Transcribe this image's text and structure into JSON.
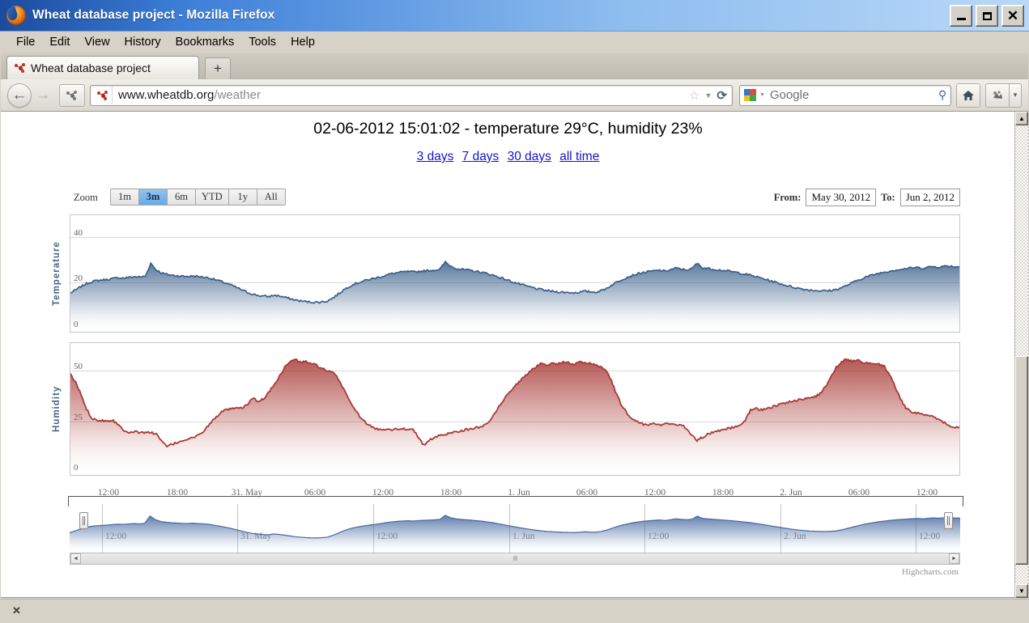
{
  "window": {
    "title": "Wheat database project - Mozilla Firefox",
    "minimize_label": "Minimize",
    "maximize_label": "Maximize",
    "close_label": "Close"
  },
  "menubar": {
    "items": [
      {
        "label": "File"
      },
      {
        "label": "Edit"
      },
      {
        "label": "View"
      },
      {
        "label": "History"
      },
      {
        "label": "Bookmarks"
      },
      {
        "label": "Tools"
      },
      {
        "label": "Help"
      }
    ]
  },
  "tabs": {
    "active_tab_title": "Wheat database project",
    "new_tab_label": "+"
  },
  "navbar": {
    "back_label": "←",
    "forward_label": "→",
    "reload_label": "↻",
    "url_host": "www.wheatdb.org",
    "url_path": "/weather",
    "star_label": "☆",
    "dropmarker_label": "▼",
    "reload_stop_label": "⟳",
    "search_engine": "Google",
    "search_placeholder": "Google",
    "search_icon_label": "⚲",
    "home_label": "⌂",
    "bookmarks_label": "❦",
    "bookmarks_caret": "▾"
  },
  "page": {
    "heading": "02-06-2012 15:01:02 - temperature 29°C, humidity 23%",
    "links": [
      {
        "label": "3 days"
      },
      {
        "label": "7 days"
      },
      {
        "label": "30 days"
      },
      {
        "label": "all time"
      }
    ],
    "credit": "Highcharts.com"
  },
  "rangeselector": {
    "zoom_label": "Zoom",
    "buttons": [
      {
        "label": "1m",
        "selected": false
      },
      {
        "label": "3m",
        "selected": true
      },
      {
        "label": "6m",
        "selected": false
      },
      {
        "label": "YTD",
        "selected": false
      },
      {
        "label": "1y",
        "selected": false
      },
      {
        "label": "All",
        "selected": false
      }
    ],
    "from_label": "From:",
    "from_value": "May 30, 2012",
    "to_label": "To:",
    "to_value": "Jun 2, 2012"
  },
  "navigator": {
    "scroll_left_label": "◄",
    "scroll_right_label": "►",
    "grip_label": "‖‖",
    "inner_ticks": [
      {
        "label": "12:00",
        "x": 40
      },
      {
        "label": "31. May",
        "x": 207
      },
      {
        "label": "12:00",
        "x": 375
      },
      {
        "label": "1. Jun",
        "x": 543
      },
      {
        "label": "12:00",
        "x": 710
      },
      {
        "label": "2. Jun",
        "x": 878
      },
      {
        "label": "12:00",
        "x": 1045
      }
    ]
  },
  "chart_data": [
    {
      "type": "area",
      "title": "Temperature",
      "ylabel": "Temperature",
      "xlabel": "",
      "ylim": [
        0,
        48
      ],
      "yticks": [
        0,
        20,
        40
      ],
      "grid": true,
      "color": "#3b5f8a",
      "xticks": [
        {
          "label": "12:00",
          "x": 48
        },
        {
          "label": "18:00",
          "x": 133
        },
        {
          "label": "31. May",
          "x": 219
        },
        {
          "label": "06:00",
          "x": 303
        },
        {
          "label": "12:00",
          "x": 387
        },
        {
          "label": "18:00",
          "x": 471
        },
        {
          "label": "1. Jun",
          "x": 555
        },
        {
          "label": "06:00",
          "x": 639
        },
        {
          "label": "12:00",
          "x": 723
        },
        {
          "label": "18:00",
          "x": 807
        },
        {
          "label": "2. Jun",
          "x": 891
        },
        {
          "label": "06:00",
          "x": 975
        },
        {
          "label": "12:00",
          "x": 1059
        }
      ],
      "values": [
        15.5,
        16.8,
        18.3,
        19.6,
        20.4,
        20.9,
        21.2,
        21.4,
        21.8,
        22.1,
        22.0,
        22.3,
        22.6,
        22.4,
        22.8,
        28.5,
        25.6,
        24.2,
        23.6,
        23.2,
        23.0,
        22.8,
        22.7,
        22.9,
        22.6,
        22.4,
        22.0,
        21.3,
        20.6,
        19.8,
        18.9,
        17.9,
        16.8,
        15.8,
        15.0,
        14.4,
        14.1,
        13.9,
        14.5,
        14.2,
        13.6,
        13.0,
        12.4,
        12.0,
        11.7,
        11.5,
        11.4,
        11.6,
        12.0,
        13.3,
        15.0,
        16.8,
        18.3,
        19.4,
        20.2,
        20.9,
        21.5,
        22.0,
        22.6,
        23.3,
        23.9,
        24.3,
        24.6,
        24.8,
        24.6,
        24.9,
        25.1,
        25.3,
        25.5,
        25.8,
        29.0,
        27.2,
        26.3,
        25.8,
        25.5,
        25.2,
        24.8,
        24.4,
        23.8,
        23.2,
        22.4,
        21.6,
        20.8,
        20.0,
        19.3,
        18.6,
        18.0,
        17.4,
        16.9,
        16.5,
        16.2,
        16.0,
        15.8,
        15.7,
        15.6,
        15.8,
        16.2,
        16.0,
        15.9,
        16.4,
        17.4,
        18.8,
        20.2,
        21.4,
        22.4,
        23.2,
        23.9,
        24.4,
        24.8,
        25.1,
        25.4,
        25.0,
        25.6,
        26.3,
        25.9,
        25.6,
        26.0,
        28.4,
        26.6,
        26.2,
        25.9,
        25.6,
        25.3,
        25.0,
        24.6,
        24.2,
        23.7,
        23.2,
        22.6,
        22.0,
        21.3,
        20.6,
        19.9,
        19.2,
        18.6,
        18.0,
        17.5,
        17.1,
        16.8,
        16.6,
        16.5,
        16.4,
        16.6,
        17.0,
        17.8,
        18.8,
        19.9,
        21.0,
        22.0,
        22.8,
        23.5,
        24.1,
        24.6,
        25.1,
        25.5,
        25.8,
        26.1,
        26.4,
        26.6,
        26.3,
        26.7,
        27.0,
        26.8,
        27.1,
        27.3,
        27.0,
        26.9
      ]
    },
    {
      "type": "area",
      "title": "Humidity",
      "ylabel": "Humidity",
      "xlabel": "",
      "ylim": [
        0,
        62
      ],
      "yticks": [
        0,
        25,
        50
      ],
      "grid": true,
      "color": "#a83a36",
      "values": [
        48.0,
        44.0,
        38.0,
        31.0,
        26.5,
        25.5,
        25.3,
        25.2,
        25.4,
        23.0,
        20.5,
        19.5,
        19.8,
        19.2,
        19.6,
        19.3,
        18.8,
        15.0,
        12.5,
        13.5,
        14.5,
        15.5,
        16.2,
        17.0,
        18.0,
        20.5,
        23.5,
        26.5,
        29.0,
        30.5,
        31.0,
        31.2,
        31.5,
        33.0,
        36.5,
        34.5,
        36.0,
        39.0,
        43.0,
        47.0,
        51.5,
        54.5,
        55.5,
        54.0,
        54.5,
        53.5,
        52.5,
        51.0,
        49.5,
        49.0,
        46.0,
        41.0,
        36.0,
        31.0,
        27.5,
        24.5,
        22.5,
        21.2,
        20.8,
        21.2,
        20.9,
        21.1,
        21.3,
        21.0,
        21.2,
        16.5,
        13.0,
        15.5,
        17.0,
        17.8,
        18.5,
        19.2,
        19.8,
        20.3,
        20.8,
        21.3,
        21.8,
        22.5,
        24.5,
        28.0,
        32.0,
        36.0,
        39.5,
        42.5,
        45.0,
        47.5,
        50.0,
        52.0,
        53.5,
        53.0,
        53.8,
        53.2,
        54.5,
        53.8,
        52.8,
        54.2,
        53.5,
        53.8,
        53.0,
        52.0,
        50.0,
        45.0,
        38.0,
        32.5,
        28.5,
        26.0,
        24.5,
        23.5,
        23.3,
        23.6,
        23.2,
        23.5,
        23.8,
        23.4,
        23.2,
        21.5,
        18.0,
        15.5,
        17.0,
        18.5,
        19.5,
        20.3,
        21.0,
        21.5,
        22.0,
        22.5,
        25.5,
        30.5,
        31.5,
        30.5,
        31.0,
        32.0,
        33.0,
        33.5,
        34.5,
        35.0,
        35.5,
        36.0,
        36.5,
        37.0,
        38.5,
        42.0,
        47.0,
        51.5,
        54.5,
        55.5,
        54.5,
        55.0,
        54.2,
        53.5,
        53.8,
        53.0,
        52.0,
        48.0,
        42.0,
        36.0,
        31.5,
        29.5,
        29.0,
        28.5,
        28.0,
        27.0,
        26.0,
        24.5,
        23.0,
        22.0,
        21.5
      ]
    },
    {
      "type": "area",
      "title": "Navigator",
      "ylim": [
        0,
        34
      ],
      "grid": false,
      "color": "#4668a0",
      "values": [
        15.5,
        16.8,
        18.3,
        19.6,
        20.4,
        20.9,
        21.2,
        21.4,
        21.8,
        22.1,
        22.0,
        22.3,
        22.6,
        22.4,
        22.8,
        28.5,
        25.6,
        24.2,
        23.6,
        23.2,
        23.0,
        22.8,
        22.7,
        22.9,
        22.6,
        22.4,
        22.0,
        21.3,
        20.6,
        19.8,
        18.9,
        17.9,
        16.8,
        15.8,
        15.0,
        14.4,
        14.1,
        13.9,
        14.5,
        14.2,
        13.6,
        13.0,
        12.4,
        12.0,
        11.7,
        11.5,
        11.4,
        11.6,
        12.0,
        13.3,
        15.0,
        16.8,
        18.3,
        19.4,
        20.2,
        20.9,
        21.5,
        22.0,
        22.6,
        23.3,
        23.9,
        24.3,
        24.6,
        24.8,
        24.6,
        24.9,
        25.1,
        25.3,
        25.5,
        25.8,
        29.0,
        27.2,
        26.3,
        25.8,
        25.5,
        25.2,
        24.8,
        24.4,
        23.8,
        23.2,
        22.4,
        21.6,
        20.8,
        20.0,
        19.3,
        18.6,
        18.0,
        17.4,
        16.9,
        16.5,
        16.2,
        16.0,
        15.8,
        15.7,
        15.6,
        15.8,
        16.2,
        16.0,
        15.9,
        16.4,
        17.4,
        18.8,
        20.2,
        21.4,
        22.4,
        23.2,
        23.9,
        24.4,
        24.8,
        25.1,
        25.4,
        25.0,
        25.6,
        26.3,
        25.9,
        25.6,
        26.0,
        28.4,
        26.6,
        26.2,
        25.9,
        25.6,
        25.3,
        25.0,
        24.6,
        24.2,
        23.7,
        23.2,
        22.6,
        22.0,
        21.3,
        20.6,
        19.9,
        19.2,
        18.6,
        18.0,
        17.5,
        17.1,
        16.8,
        16.6,
        16.5,
        16.4,
        16.6,
        17.0,
        17.8,
        18.8,
        19.9,
        21.0,
        22.0,
        22.8,
        23.5,
        24.1,
        24.6,
        25.1,
        25.5,
        25.8,
        26.1,
        26.4,
        26.6,
        26.3,
        26.7,
        27.0,
        26.8,
        27.1,
        27.3,
        27.0,
        26.9
      ]
    }
  ],
  "findbar": {
    "close_label": "✕"
  },
  "scrollbar": {
    "up_label": "▲",
    "down_label": "▼"
  },
  "colors": {
    "temperature": "#3b5f8a",
    "humidity": "#a83a36",
    "link": "#1414d0",
    "titlebar": "#3d7fd8"
  }
}
